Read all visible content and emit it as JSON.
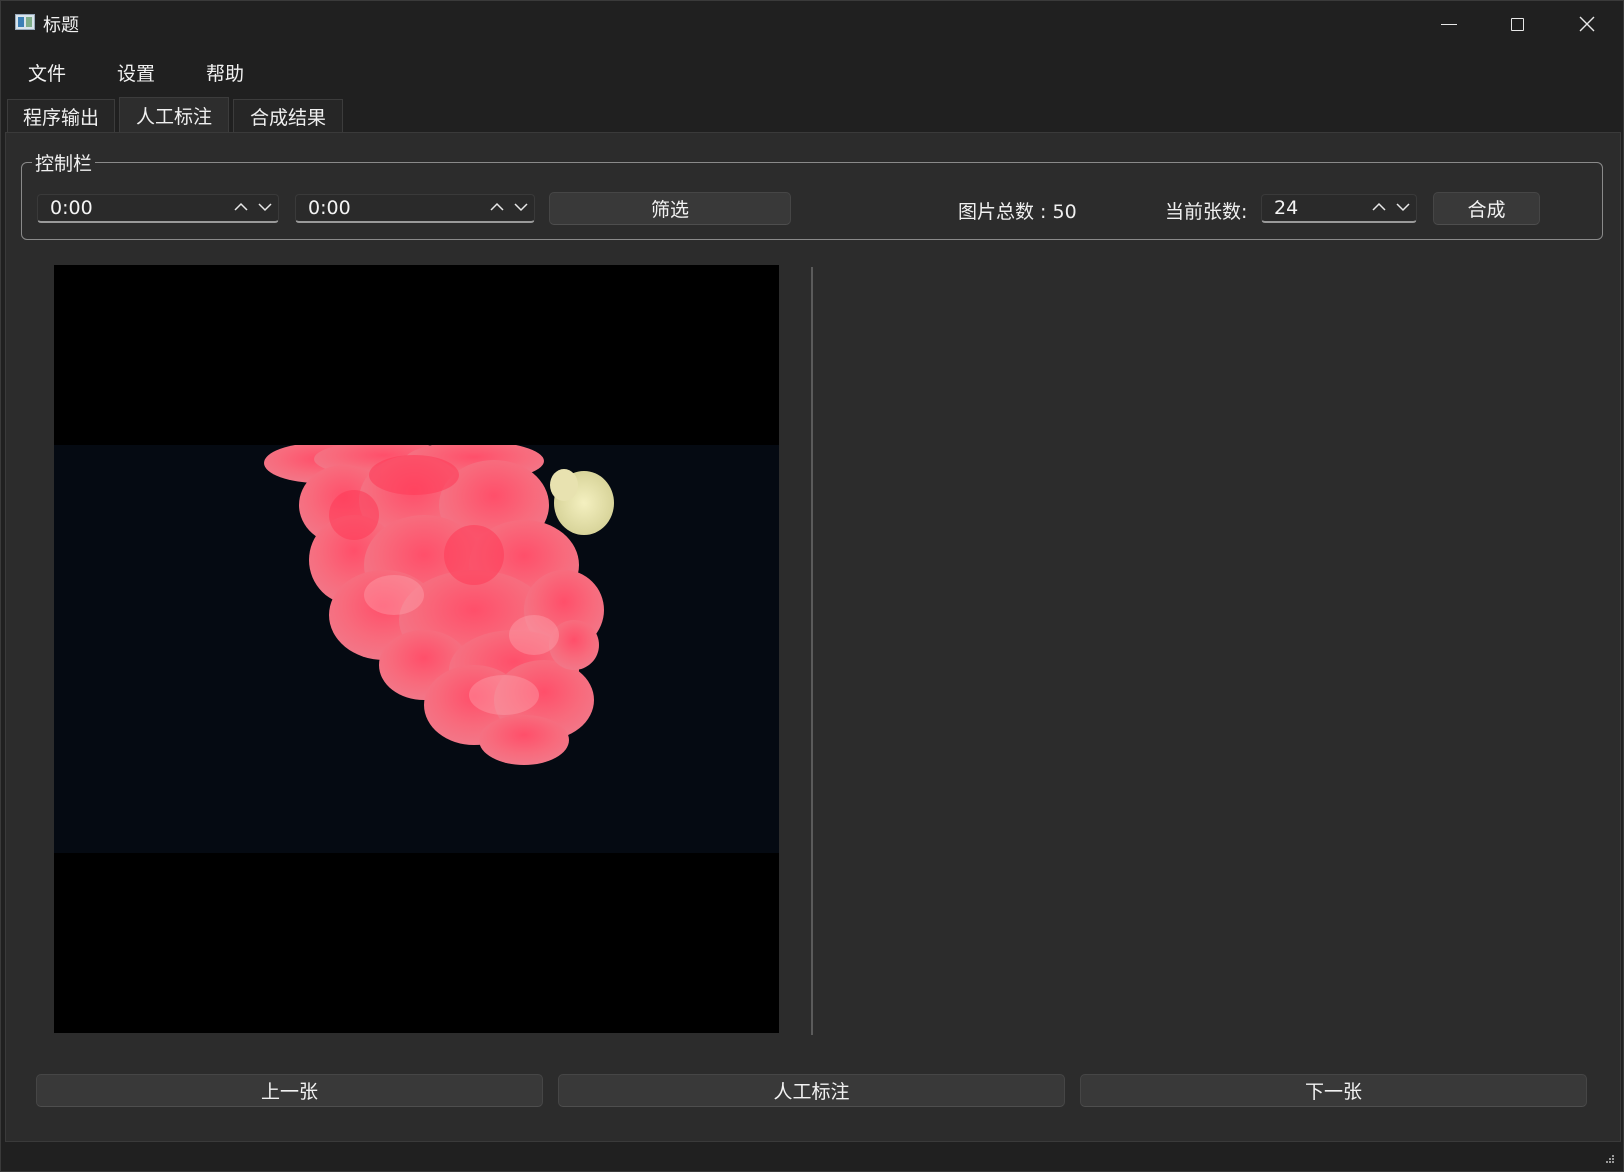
{
  "window": {
    "title": "标题",
    "controls": [
      "minimize-icon",
      "maximize-icon",
      "close-icon"
    ]
  },
  "menu": {
    "items": [
      {
        "label": "文件"
      },
      {
        "label": "设置"
      },
      {
        "label": "帮助"
      }
    ]
  },
  "tabs": [
    {
      "label": "程序输出",
      "active": false
    },
    {
      "label": "人工标注",
      "active": true
    },
    {
      "label": "合成结果",
      "active": false
    }
  ],
  "control_bar": {
    "title": "控制栏",
    "start_time": "0:00",
    "end_time": "0:00",
    "filter_label": "筛选",
    "total_label": "图片总数 : 50",
    "current_label": "当前张数:",
    "current_value": "24",
    "compose_label": "合成"
  },
  "nav": {
    "prev_label": "上一张",
    "annotate_label": "人工标注",
    "next_label": "下一张"
  },
  "colors": {
    "window_bg": "#202020",
    "panel_bg": "#2c2c2c",
    "button_bg": "#393939",
    "smoke_pink": "#f7667a"
  }
}
